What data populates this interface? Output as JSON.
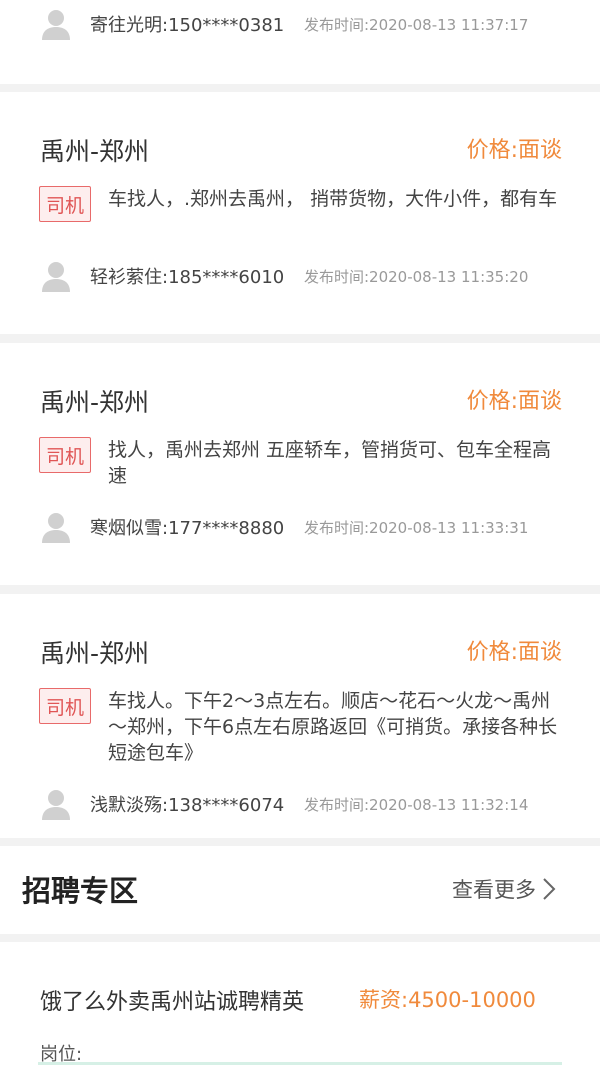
{
  "listings": [
    {
      "user": "寄往光明:150****0381",
      "time": "发布时间:2020-08-13 11:37:17"
    },
    {
      "route": "禹州-郑州",
      "price": "价格:面谈",
      "badge": "司机",
      "desc": "车找人，.郑州去禹州， 捎带货物，大件小件，都有车",
      "user": "轻衫萦住:185****6010",
      "time": "发布时间:2020-08-13 11:35:20"
    },
    {
      "route": "禹州-郑州",
      "price": "价格:面谈",
      "badge": "司机",
      "desc": "找人，禹州去郑州 五座轿车，管捎货可、包车全程高速",
      "user": "寒烟似雪:177****8880",
      "time": "发布时间:2020-08-13 11:33:31"
    },
    {
      "route": "禹州-郑州",
      "price": "价格:面谈",
      "badge": "司机",
      "desc": "车找人。下午2～3点左右。顺店～花石～火龙～禹州～郑州，下午6点左右原路返回《可捎货。承接各种长短途包车》",
      "user": "浅默淡殇:138****6074",
      "time": "发布时间:2020-08-13 11:32:14"
    }
  ],
  "recruit": {
    "title": "招聘专区",
    "more": "查看更多",
    "job_title": "饿了么外卖禹州站诚聘精英",
    "salary": "薪资:4500-10000",
    "position_label": "岗位:"
  },
  "colors": {
    "accent": "#f08a3c",
    "badge": "#e05555"
  }
}
